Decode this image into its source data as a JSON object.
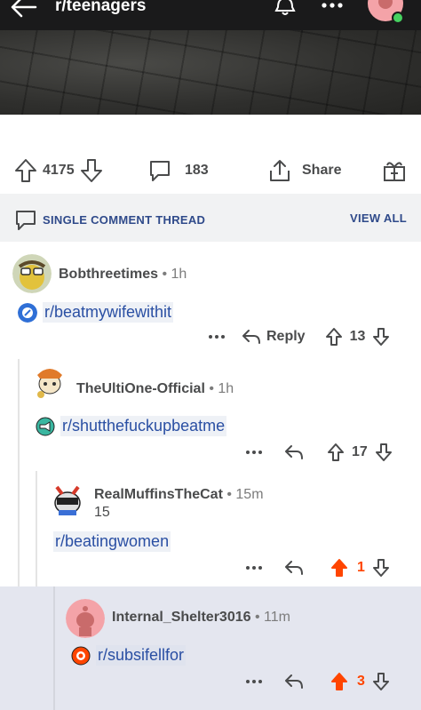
{
  "header": {
    "subreddit": "r/teenagers"
  },
  "post_actions": {
    "upvotes": "4175",
    "comments": "183",
    "share_label": "Share"
  },
  "thread_bar": {
    "title": "SINGLE COMMENT THREAD",
    "view_all": "VIEW ALL"
  },
  "comments": [
    {
      "author": "Bobthreetimes",
      "time": " • 1h",
      "body": "r/beatmywifewithit",
      "reply_label": "Reply",
      "score": "13"
    },
    {
      "author": "TheUltiOne-Official",
      "time": " • 1h",
      "body": "r/shutthefuckupbeatme",
      "score": "17"
    },
    {
      "author": "RealMuffinsTheCat",
      "time": " • 15m",
      "subline": "15",
      "body": "r/beatingwomen",
      "score": "1"
    },
    {
      "author": "Internal_Shelter3016",
      "time": " • 11m",
      "body": "r/subsifellfor",
      "score": "3"
    }
  ],
  "colors": {
    "topbar": "#1a1a1b",
    "link": "#2a4fa3",
    "upvoted": "#ff4500",
    "thread_bar": "#f1f2f3",
    "highlight": "#e4e6ef"
  }
}
